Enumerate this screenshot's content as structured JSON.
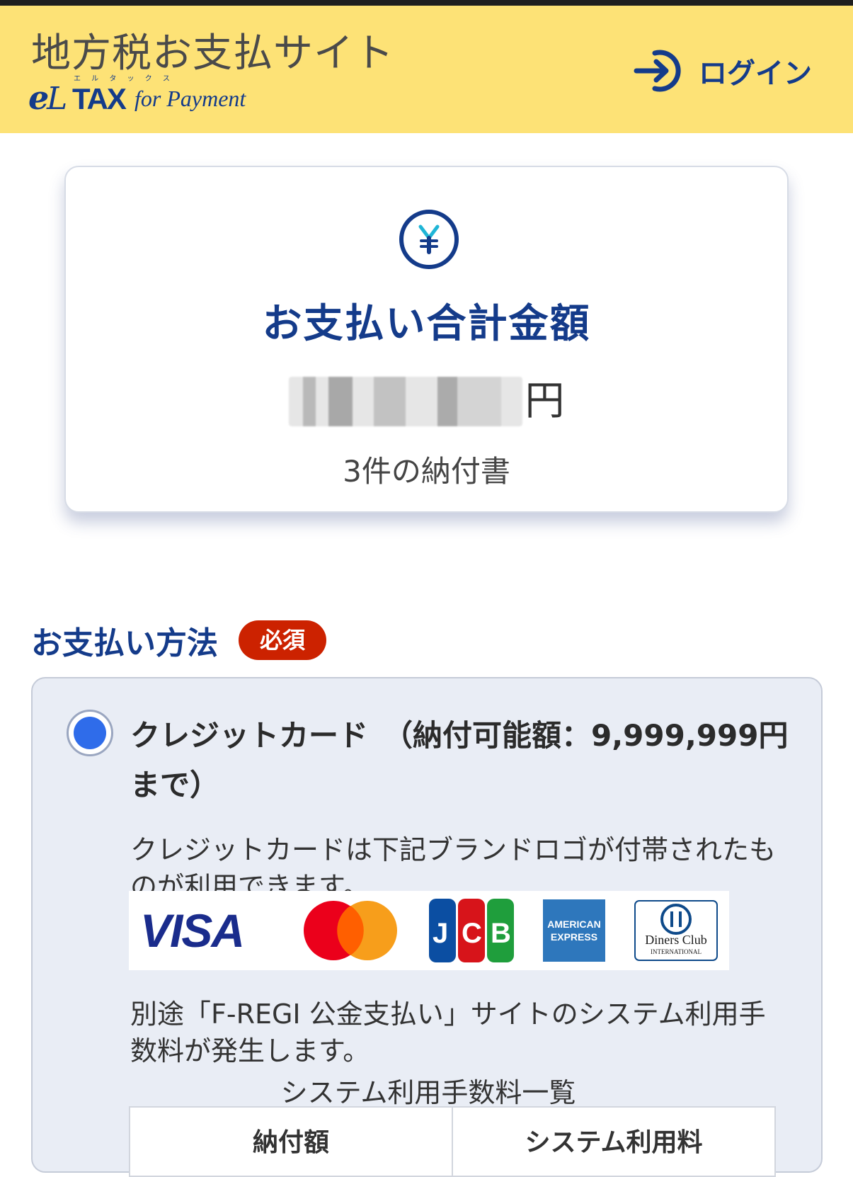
{
  "header": {
    "site_title": "地方税お支払サイト",
    "logo_text": "eLTAX for Payment",
    "logo_ruby": "エ ル タ ッ ク ス",
    "login_label": "ログイン"
  },
  "summary": {
    "title": "お支払い合計金額",
    "amount_masked": "",
    "currency": "円",
    "count_text": "3件の納付書"
  },
  "payment_method": {
    "title": "お支払い方法",
    "required_badge": "必須",
    "options": [
      {
        "label": "クレジットカード　（納付可能額：9,999,999円まで）",
        "selected": true,
        "description": "クレジットカードは下記ブランドロゴが付帯されたものが利用できます。",
        "brands": [
          "VISA",
          "Mastercard",
          "JCB",
          "AMERICAN EXPRESS",
          "Diners Club INTERNATIONAL"
        ],
        "fee_note": "別途「F-REGI 公金支払い」サイトのシステム利用手数料が発生します。",
        "fee_table_title": "システム利用手数料一覧",
        "fee_table_headers": [
          "納付額",
          "システム利用料"
        ]
      }
    ]
  },
  "colors": {
    "header_bg": "#fde276",
    "brand_navy": "#143b8a",
    "required_red": "#cc2200",
    "radio_blue": "#2f6cea"
  }
}
